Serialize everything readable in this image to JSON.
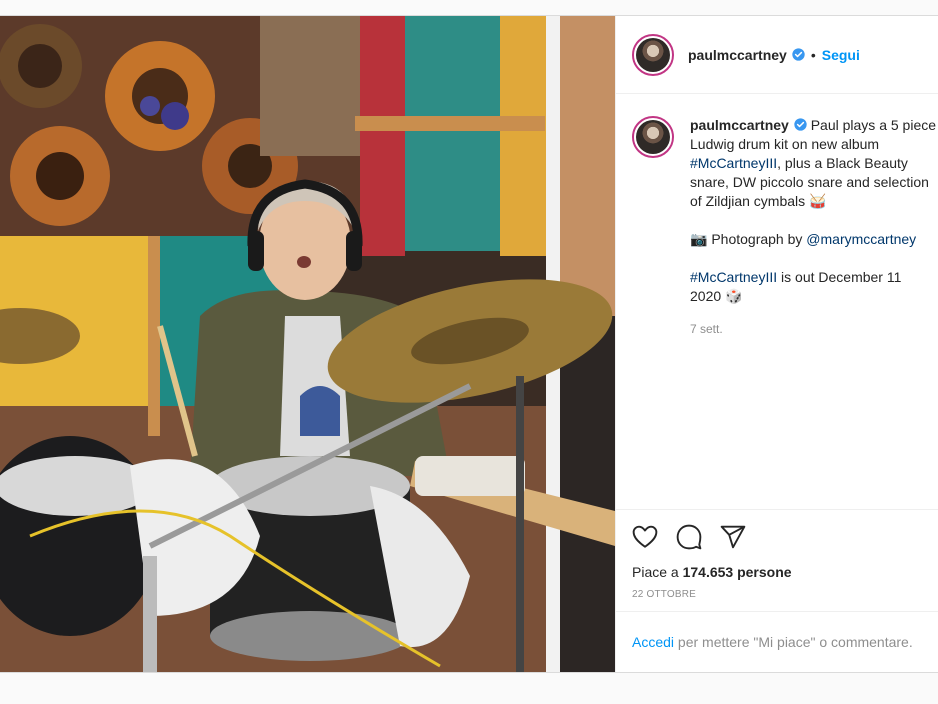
{
  "post": {
    "username": "paulmccartney",
    "follow_label": "Segui",
    "separator": "•",
    "caption_lines": [
      "Paul plays a 5 piece",
      "Ludwig drum kit on new album",
      "#McCartneyIII, plus a Black Beauty",
      "snare, DW piccolo snare and selection",
      "of Zildjian cymbals 🥁"
    ],
    "photo_credit_prefix": "📷 Photograph by ",
    "photo_credit_handle": "@marymccartney",
    "release_hashtag": "#McCartneyIII",
    "release_text": " is out December 11",
    "release_text2": "2020 🎲",
    "time_ago": "7 sett.",
    "likes_prefix": "Piace a ",
    "likes_count": "174.653",
    "likes_suffix": " persone",
    "date": "22 OTTOBRE",
    "login_link": "Accedi",
    "login_text": " per mettere \"Mi piace\" o commentare."
  },
  "icons": [
    "verified-badge-icon",
    "heart-icon",
    "comment-icon",
    "share-icon"
  ],
  "colors": {
    "accent": "#0095f6",
    "link": "#00376b",
    "muted": "#8e8e8e",
    "verified": "#3897f0"
  }
}
